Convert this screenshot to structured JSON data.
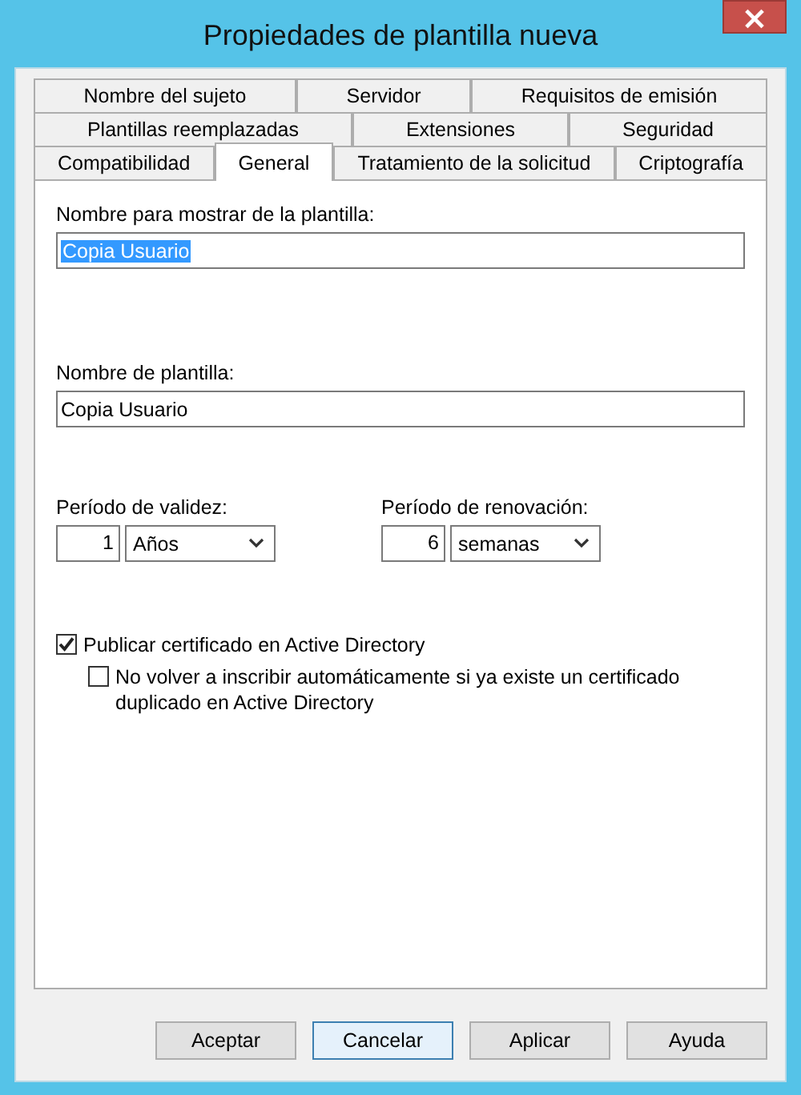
{
  "window": {
    "title": "Propiedades de plantilla nueva",
    "close": "×"
  },
  "tab_rows": [
    [
      {
        "label": "Nombre del sujeto",
        "selected": false
      },
      {
        "label": "Servidor",
        "selected": false
      },
      {
        "label": "Requisitos de emisión",
        "selected": false
      }
    ],
    [
      {
        "label": "Plantillas reemplazadas",
        "selected": false
      },
      {
        "label": "Extensiones",
        "selected": false
      },
      {
        "label": "Seguridad",
        "selected": false
      }
    ],
    [
      {
        "label": "Compatibilidad",
        "selected": false
      },
      {
        "label": "General",
        "selected": true
      },
      {
        "label": "Tratamiento de la solicitud",
        "selected": false
      },
      {
        "label": "Criptografía",
        "selected": false
      }
    ]
  ],
  "display_name": {
    "label": "Nombre para mostrar de la plantilla:",
    "value": "Copia Usuario",
    "text_selected": true
  },
  "template_name": {
    "label": "Nombre de plantilla:",
    "value": "Copia Usuario",
    "text_selected": false
  },
  "periods": [
    {
      "label": "Período de validez:",
      "number": "1",
      "unit": "Años"
    },
    {
      "label": "Período de renovación:",
      "number": "6",
      "unit": "semanas"
    }
  ],
  "checkboxes": [
    {
      "label": "Publicar certificado en Active Directory",
      "checked": true,
      "children": [
        {
          "label": "No volver a inscribir automáticamente si ya existe un certificado duplicado en Active Directory",
          "checked": false
        }
      ]
    }
  ],
  "buttons": [
    {
      "label": "Aceptar",
      "focused": false
    },
    {
      "label": "Cancelar",
      "focused": true
    },
    {
      "label": "Aplicar",
      "focused": false
    },
    {
      "label": "Ayuda",
      "focused": false
    }
  ]
}
